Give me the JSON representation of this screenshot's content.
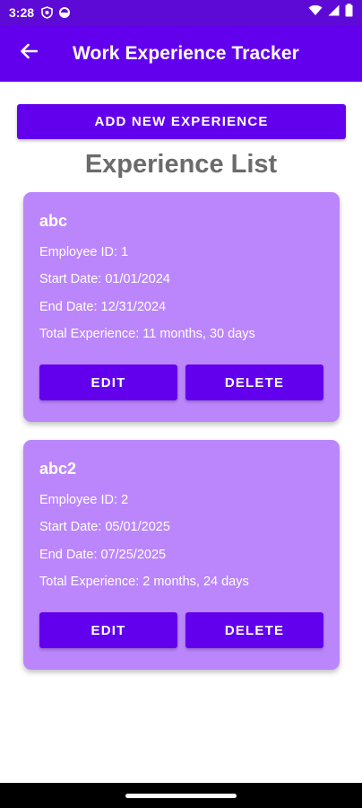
{
  "status_bar": {
    "time": "3:28",
    "icons": [
      "shield-icon",
      "face-icon"
    ],
    "right_icons": [
      "wifi-icon",
      "signal-icon",
      "battery-icon"
    ]
  },
  "app_bar": {
    "title": "Work Experience Tracker",
    "back_icon": "arrow-back-icon"
  },
  "add_button": {
    "label": "ADD NEW EXPERIENCE"
  },
  "list_title": "Experience List",
  "experiences": [
    {
      "name": "abc",
      "employee_id": "Employee ID: 1",
      "start_date": "Start Date: 01/01/2024",
      "end_date": "End Date: 12/31/2024",
      "total": "Total Experience: 11 months, 30 days",
      "edit_label": "EDIT",
      "delete_label": "DELETE"
    },
    {
      "name": "abc2",
      "employee_id": "Employee ID: 2",
      "start_date": "Start Date: 05/01/2025",
      "end_date": "End Date: 07/25/2025",
      "total": "Total Experience: 2 months, 24 days",
      "edit_label": "EDIT",
      "delete_label": "DELETE"
    }
  ],
  "colors": {
    "primary": "#6200ee",
    "status_bar": "#5e0ad6",
    "card": "#bb86fc",
    "title_text": "#6b6b6b"
  }
}
